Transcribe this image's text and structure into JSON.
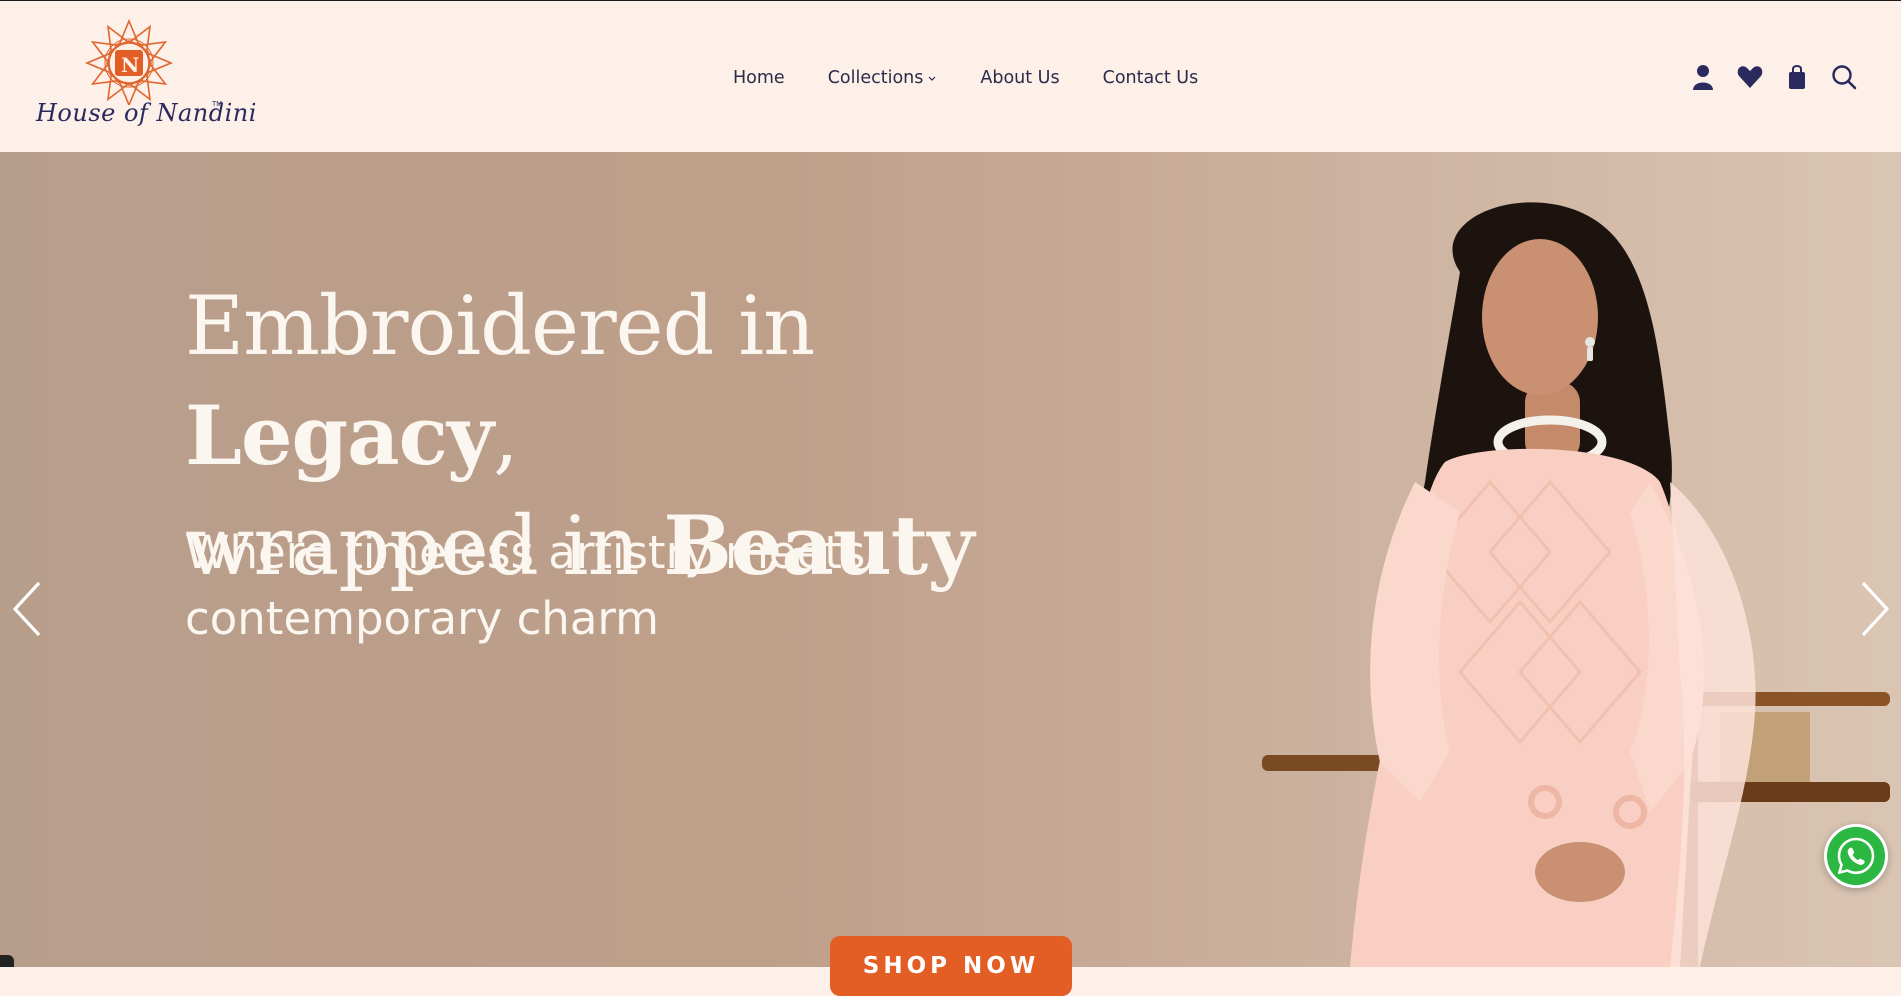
{
  "brand": {
    "name": "House of Nandini",
    "trademark": "TM",
    "monogram": "N",
    "colors": {
      "accent": "#e35e24",
      "navy": "#2a2a5e",
      "header_bg": "#fcf0e8"
    }
  },
  "nav": {
    "items": [
      {
        "label": "Home"
      },
      {
        "label": "Collections",
        "has_dropdown": true
      },
      {
        "label": "About Us"
      },
      {
        "label": "Contact Us"
      }
    ]
  },
  "header_icons": [
    "account-icon",
    "wishlist-heart-icon",
    "cart-bag-icon",
    "search-icon"
  ],
  "hero": {
    "headline_line1_regular": "Embroidered in ",
    "headline_line1_bold": "Legacy",
    "headline_line1_end": ",",
    "headline_line2_regular": "wrapped in ",
    "headline_line2_bold": "Beauty",
    "subheadline": "Where timeless artistry meets contemporary charm",
    "cta_label": "SHOP NOW",
    "prev_icon": "chevron-left-icon",
    "next_icon": "chevron-right-icon"
  },
  "floating": {
    "whatsapp_icon": "whatsapp-icon"
  }
}
